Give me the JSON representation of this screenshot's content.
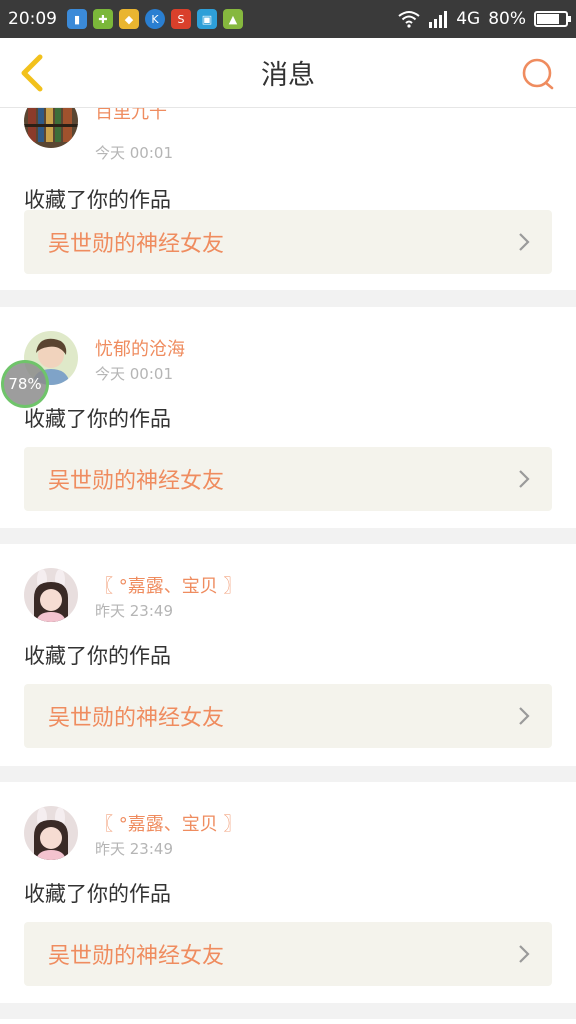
{
  "status_bar": {
    "time": "20:09",
    "network": "4G",
    "battery": "80%",
    "battery_level": 0.8,
    "app_icons": [
      "notification-icon",
      "game-icon",
      "store-icon",
      "k-app-icon",
      "s-app-icon",
      "scan-icon",
      "android-icon"
    ]
  },
  "nav": {
    "title": "消息"
  },
  "floating_badge": "78%",
  "messages": [
    {
      "user": "百里九千",
      "time": "今天 00:01",
      "action": "收藏了你的作品",
      "work_title": "吴世勋的神经女友"
    },
    {
      "user": "忧郁的沧海",
      "time": "今天 00:01",
      "action": "收藏了你的作品",
      "work_title": "吴世勋的神经女友"
    },
    {
      "user": "〖 °嘉露、宝贝 〗",
      "time": "昨天 23:49",
      "action": "收藏了你的作品",
      "work_title": "吴世勋的神经女友"
    },
    {
      "user": "〖 °嘉露、宝贝 〗",
      "time": "昨天 23:49",
      "action": "收藏了你的作品",
      "work_title": "吴世勋的神经女友"
    }
  ],
  "colors": {
    "accent": "#ef8c5f",
    "nav_back": "#f2c11c",
    "status_bar_bg": "#3a3a3a",
    "card_bg": "#ffffff",
    "work_bg": "#f4f3ec"
  }
}
